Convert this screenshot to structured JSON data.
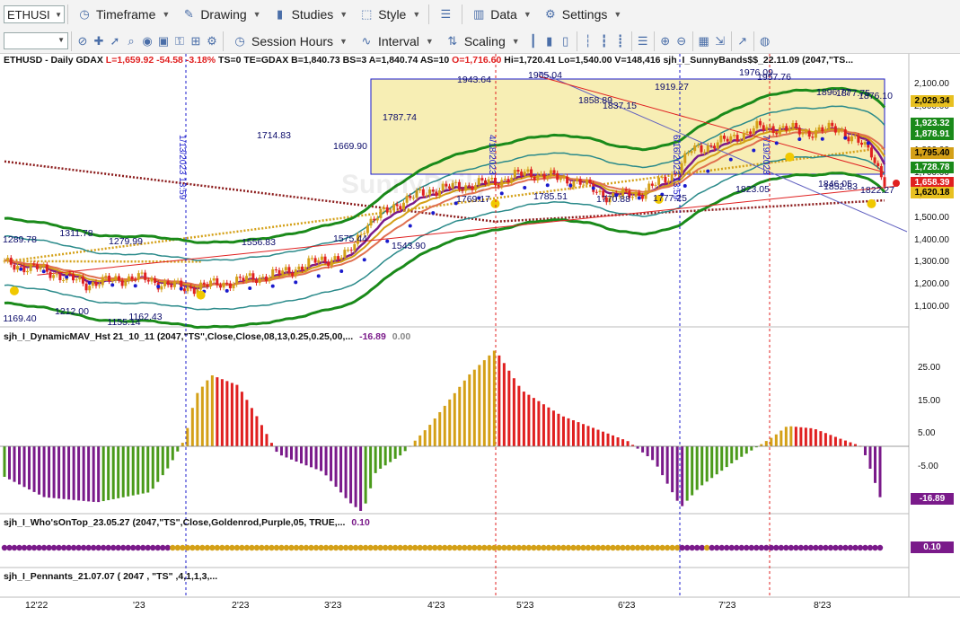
{
  "toolbar1": {
    "symbol": "ETHUSI",
    "timeframe": "Timeframe",
    "drawing": "Drawing",
    "studies": "Studies",
    "style": "Style",
    "data": "Data",
    "settings": "Settings"
  },
  "toolbar2": {
    "session_hours": "Session Hours",
    "interval": "Interval",
    "scaling": "Scaling"
  },
  "header": {
    "symbol": "ETHUSD - Daily  GDAX",
    "low": "L=1,659.92",
    "change": "-54.58",
    "pct": "-3.18%",
    "info": "TS=0  TE=GDAX  B=1,840.73  BS=3  A=1,840.74  AS=10",
    "open": "O=1,716.60",
    "rest": "Hi=1,720.41  Lo=1,540.00  V=148,416  sjh_I_SunnyBands$$_22.11.09 (2047,\"TS..."
  },
  "price_axis": [
    "2,100.00",
    "2,000.00",
    "1,900.00",
    "1,800.00",
    "1,700.00",
    "1,600.00",
    "1,500.00",
    "1,400.00",
    "1,300.00",
    "1,200.00",
    "1,100.00"
  ],
  "price_tags": [
    {
      "text": "2,029.34",
      "color": "#e8c020",
      "fg": "#000"
    },
    {
      "text": "1,923.32",
      "color": "#1a8a1a",
      "fg": "#fff"
    },
    {
      "text": "1,878.91",
      "color": "#1a8a1a",
      "fg": "#fff"
    },
    {
      "text": "1,795.40",
      "color": "#d4a017",
      "fg": "#000"
    },
    {
      "text": "1,728.78",
      "color": "#1a8a1a",
      "fg": "#fff"
    },
    {
      "text": "1,658.39",
      "color": "#e02020",
      "fg": "#fff"
    },
    {
      "text": "1,620.18",
      "color": "#e8c020",
      "fg": "#000"
    }
  ],
  "chart_annotations": [
    "1169.40",
    "1289.78",
    "1311.78",
    "1279.99",
    "1212.00",
    "1155.14",
    "1162.43",
    "1556.83",
    "1575.44",
    "1543.90",
    "1714.83",
    "1669.90",
    "1787.74",
    "1943.64",
    "1965.04",
    "1785.51",
    "1769.17",
    "1770.88",
    "1858.89",
    "1837.15",
    "1919.27",
    "1777.25",
    "1976.09",
    "1957.76",
    "1896.77",
    "1877.75",
    "1876.10",
    "1823.05",
    "1822.27",
    "1846.05",
    "1852.83"
  ],
  "vertical_dates": [
    "1/13/2023 13:59",
    "4/18/2023",
    "6/16/2023 13:59",
    "7/19/2023"
  ],
  "watermark": "SunnyDaily",
  "panel2": {
    "label": "sjh_I_DynamicMAV_Hst 21_10_11 (2047,\"TS\",Close,Close,08,13,0.25,0.25,00,...",
    "value1": "-16.89",
    "value2": "0.00",
    "axis": [
      "25.00",
      "15.00",
      "5.00",
      "-5.00",
      "-15.00"
    ],
    "tag": "-16.89"
  },
  "panel3": {
    "label": "sjh_I_Who'sOnTop_23.05.27 (2047,\"TS\",Close,Goldenrod,Purple,05,  TRUE,...",
    "value": "0.10",
    "tag": "0.10"
  },
  "panel4": {
    "label": "sjh_I_Pennants_21.07.07 ( 2047 , \"TS\" ,4,1,1,3,..."
  },
  "x_axis": [
    "12'22",
    "'23",
    "2'23",
    "3'23",
    "4'23",
    "5'23",
    "6'23",
    "7'23",
    "8'23"
  ],
  "colors": {
    "up": "#d4a017",
    "down": "#e02020",
    "green_band": "#1a8a1a",
    "teal_band": "#2a8a8a",
    "purple": "#7a1a8a",
    "blue": "#1a1acc",
    "box": "#f7eeb4"
  }
}
